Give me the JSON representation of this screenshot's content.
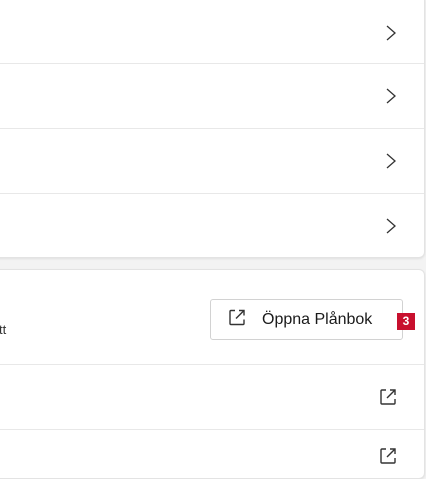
{
  "settings_list": {
    "rows": [
      {
        "chevron_icon": "chevron-right-icon"
      },
      {
        "chevron_icon": "chevron-right-icon"
      },
      {
        "chevron_icon": "chevron-right-icon"
      },
      {
        "chevron_icon": "chevron-right-icon"
      }
    ]
  },
  "wallet_section": {
    "description_tail": "tt",
    "open_wallet_label": "Öppna Plånbok",
    "open_wallet_icon": "external-link-icon",
    "badge_number": "3"
  },
  "link_rows": [
    {
      "icon": "external-link-icon"
    },
    {
      "icon": "external-link-icon"
    }
  ],
  "colors": {
    "badge": "#c8102e",
    "card_background": "#ffffff",
    "page_background": "#f3f3f3",
    "divider": "#e8e8e8"
  }
}
